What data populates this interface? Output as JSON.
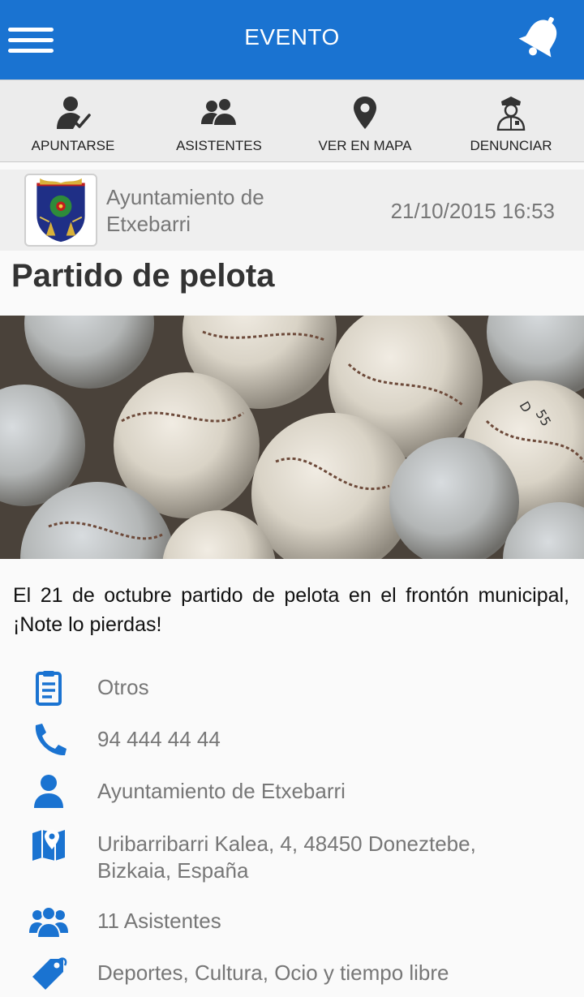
{
  "app": {
    "title": "EVENTO",
    "menu_icon": "hamburger-menu-icon",
    "notifications_icon": "bell-icon"
  },
  "colors": {
    "primary": "#1a73d1",
    "toolbar_bg": "#ececec",
    "secondary_text": "#777777",
    "title_text": "#333333"
  },
  "actions": [
    {
      "label": "APUNTARSE",
      "icon": "user-check-icon"
    },
    {
      "label": "ASISTENTES",
      "icon": "users-icon"
    },
    {
      "label": "VER EN MAPA",
      "icon": "map-pin-icon"
    },
    {
      "label": "DENUNCIAR",
      "icon": "police-officer-icon"
    }
  ],
  "organizer": {
    "name": "Ayuntamiento de Etxebarri",
    "datetime": "21/10/2015 16:53",
    "logo": "coat-of-arms-logo"
  },
  "event": {
    "title": "Partido de pelota",
    "image": "pelota-balls-photo",
    "description": "El 21 de octubre partido de pelota en el frontón municipal, ¡Note lo pierdas!"
  },
  "details": [
    {
      "icon": "clipboard-icon",
      "text": "Otros"
    },
    {
      "icon": "phone-icon",
      "text": "94 444 44 44"
    },
    {
      "icon": "person-icon",
      "text": "Ayuntamiento de Etxebarri"
    },
    {
      "icon": "map-location-icon",
      "text": "Uribarribarri Kalea, 4, 48450 Doneztebe, Bizkaia, España"
    },
    {
      "icon": "group-icon",
      "text": "11 Asistentes"
    },
    {
      "icon": "tag-icon",
      "text": "Deportes, Cultura, Ocio y tiempo libre"
    }
  ]
}
